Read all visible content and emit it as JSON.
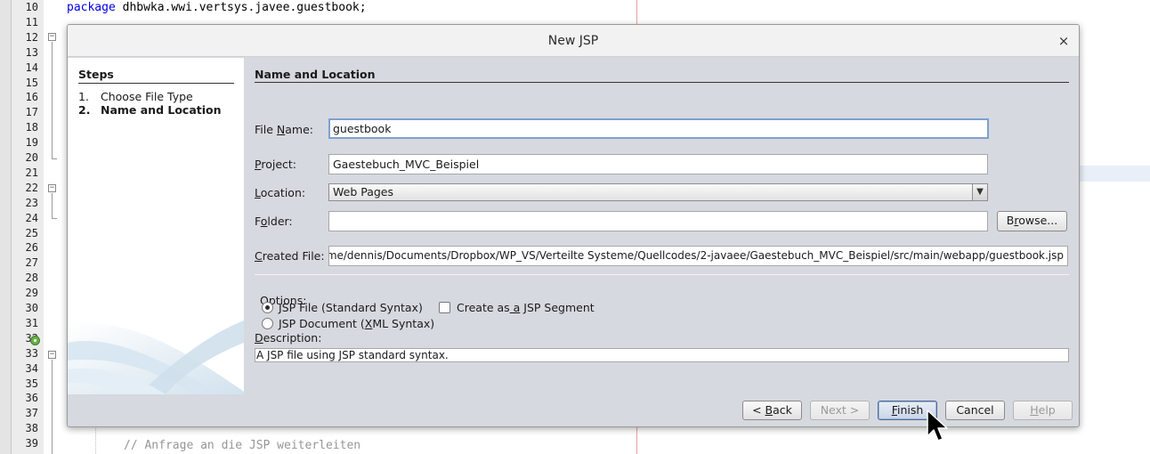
{
  "editor": {
    "line_numbers": [
      "10",
      "11",
      "12",
      "13",
      "14",
      "15",
      "16",
      "17",
      "18",
      "19",
      "20",
      "21",
      "22",
      "23",
      "24",
      "25",
      "26",
      "27",
      "28",
      "29",
      "30",
      "31",
      "32",
      "33",
      "34",
      "35",
      "36",
      "37",
      "38",
      "39"
    ],
    "line10_keyword": "package",
    "line10_rest": " dhbwka.wwi.vertsys.javee.guestbook;",
    "line39_comment": "// Anfrage an die JSP weiterleiten"
  },
  "dialog": {
    "title": "New JSP",
    "close_glyph": "×",
    "steps": {
      "title": "Steps",
      "items": [
        {
          "num": "1.",
          "label": "Choose File Type"
        },
        {
          "num": "2.",
          "label": "Name and Location"
        }
      ]
    },
    "section_title": "Name and Location",
    "fields": {
      "file_name": {
        "label_pre": "File ",
        "label_key": "N",
        "label_post": "ame:",
        "value": "guestbook"
      },
      "project": {
        "label_pre": "",
        "label_key": "P",
        "label_post": "roject:",
        "value": "Gaestebuch_MVC_Beispiel"
      },
      "location": {
        "label_pre": "",
        "label_key": "L",
        "label_post": "ocation:",
        "value": "Web Pages"
      },
      "folder": {
        "label_pre": "F",
        "label_key": "o",
        "label_post": "lder:",
        "value": ""
      },
      "created_file": {
        "label_pre": "",
        "label_key": "C",
        "label_post": "reated File:",
        "value": "me/dennis/Documents/Dropbox/WP_VS/Verteilte Systeme/Quellcodes/2-javaee/Gaestebuch_MVC_Beispiel/src/main/webapp/guestbook.jsp"
      }
    },
    "browse_button": {
      "pre": "B",
      "key": "r",
      "post": "owse..."
    },
    "options": {
      "label": "Options:",
      "jsp_file": "JSP File (Standard Syntax)",
      "jsp_document_pre": "JSP Document (",
      "jsp_document_key": "X",
      "jsp_document_post": "ML Syntax)",
      "segment_pre": "Create as",
      "segment_key": " a",
      "segment_post": " JSP Segment"
    },
    "description": {
      "label_key": "D",
      "label_post": "escription:",
      "text": "A JSP file using JSP standard syntax."
    },
    "buttons": {
      "back_pre": "< ",
      "back_key": "B",
      "back_post": "ack",
      "next": "Next >",
      "finish_key": "F",
      "finish_post": "inish",
      "cancel": "Cancel",
      "help_key": "H",
      "help_post": "elp"
    }
  }
}
